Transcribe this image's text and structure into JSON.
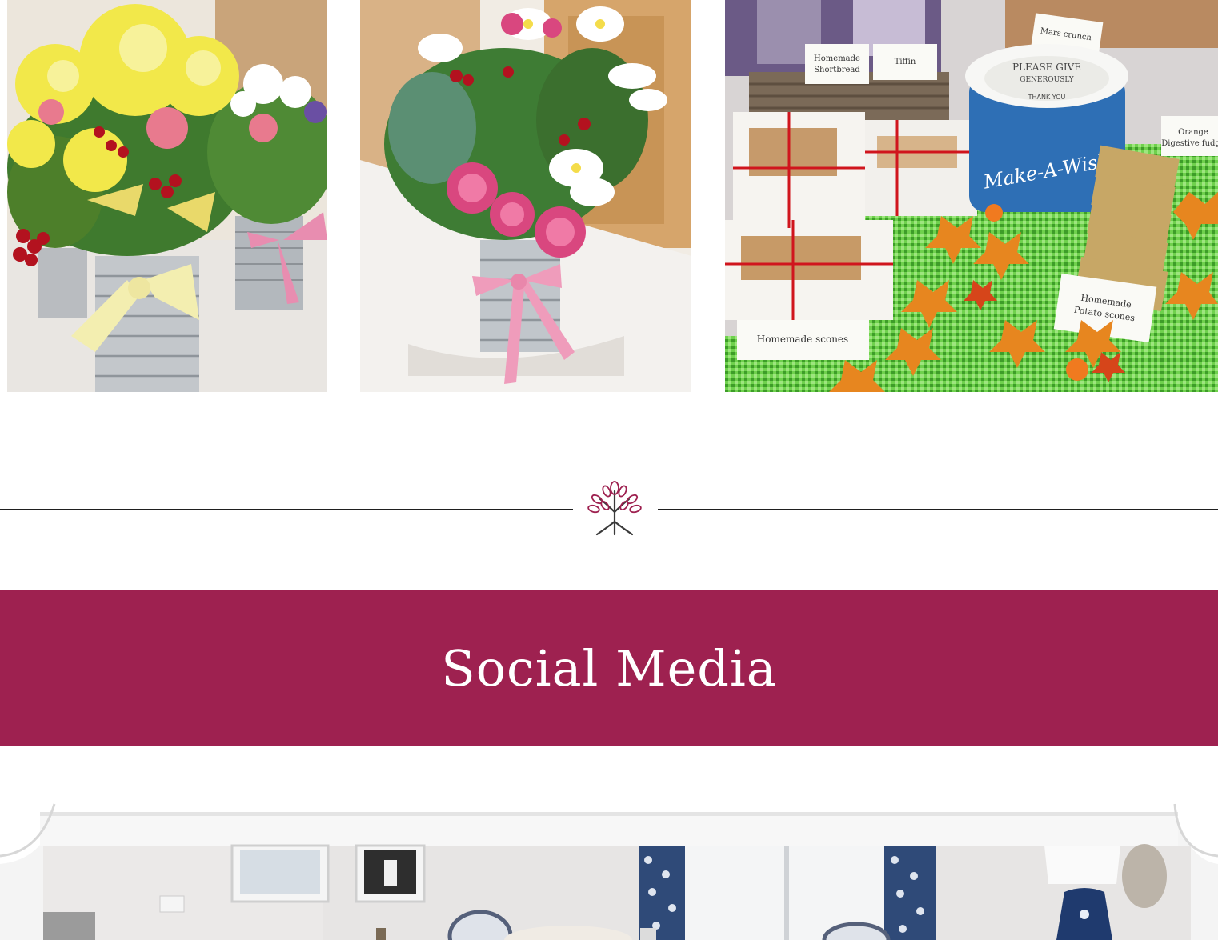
{
  "gallery": {
    "photos": [
      {
        "subject": "Yellow chrysanthemum and berry arrangements in ribboned tin cans",
        "colors": {
          "bg": "#ece6dc",
          "flower": "#f3e84a",
          "ribbon": "#f3eeb0"
        }
      },
      {
        "subject": "Pink carnation and white daisy posy in a gingham-ribboned tin",
        "colors": {
          "bg": "#f1ece4",
          "flower": "#d9477f",
          "ribbon": "#ef9cbb"
        }
      },
      {
        "subject": "Charity bake sale table with cakes, fudge and collection bucket",
        "colors": {
          "cloth": "#57c23a",
          "leaves": "#e7861f",
          "bucket": "#2e6fb5"
        },
        "labels": {
          "shortbread": "Homemade Shortbread",
          "tiffin": "Tiffin",
          "mars_crunch": "Mars crunch",
          "bucket_top": "PLEASE GIVE GENEROUSLY",
          "bucket_thanks": "THANK YOU",
          "bucket_brand": "Make-A-Wish",
          "orange_fudge": "Orange Digestive fudge",
          "scones": "Homemade scones",
          "potato_scones": "Homemade Potato scones"
        }
      }
    ]
  },
  "divider": {
    "logo_icon": "tree-logo-icon",
    "accent": "#9e2150"
  },
  "banner": {
    "title": "Social Media",
    "background": "#9e2150",
    "text_color": "#ffffff"
  },
  "social": {
    "subject": "Dining room interior with blue patterned curtains and table lamp"
  }
}
